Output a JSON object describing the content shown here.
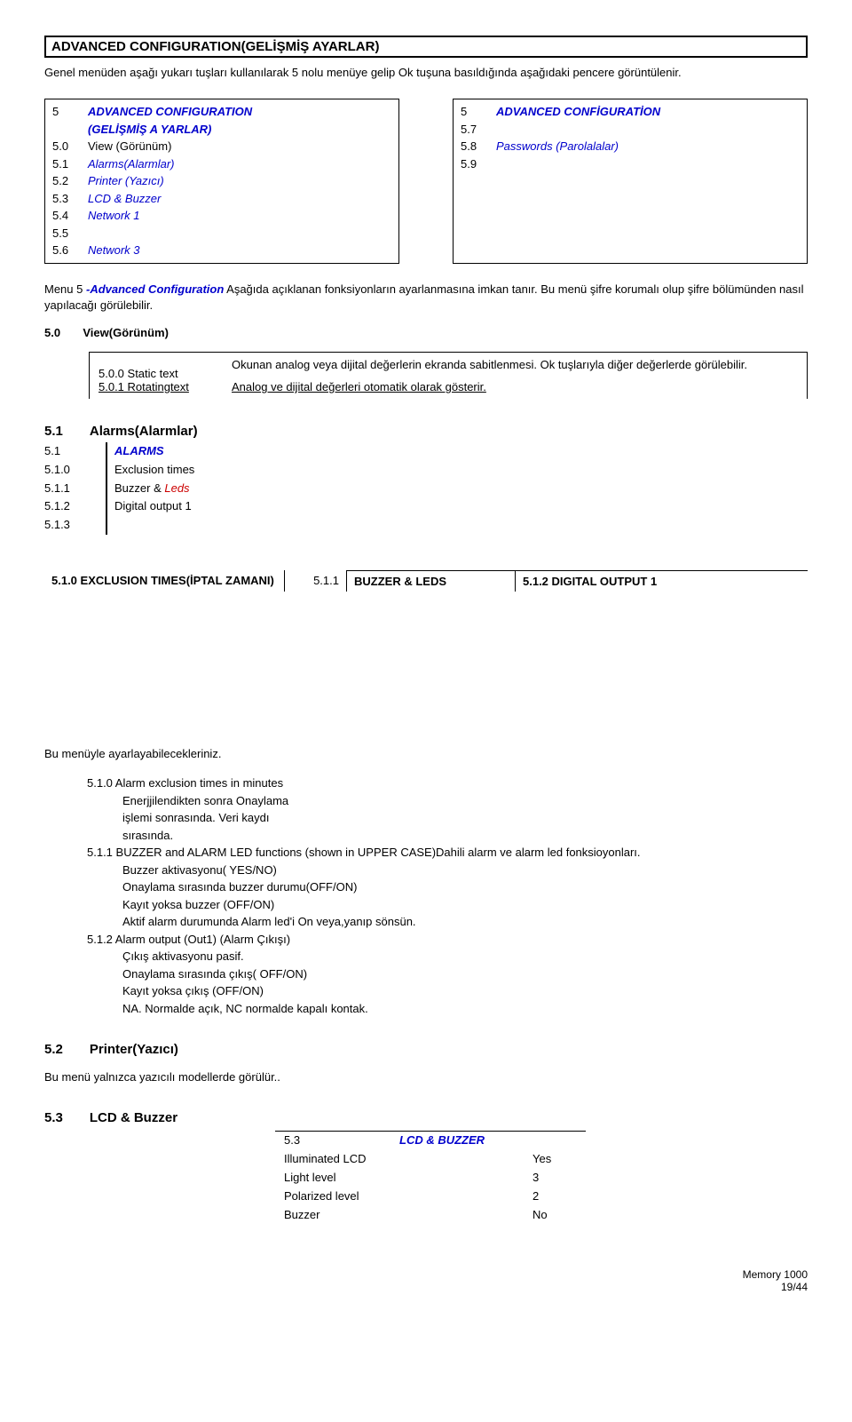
{
  "title": "ADVANCED CONFIGURATION(GELİŞMİŞ AYARLAR)",
  "intro": "Genel menüden aşağı yukarı tuşları kullanılarak 5 nolu menüye gelip Ok tuşuna basıldığında aşağıdaki pencere görüntülenir.",
  "menuLeft": {
    "items": [
      {
        "n": "5",
        "t": "ADVANCED CONFIGURATION",
        "cls": "blue-bold-italic"
      },
      {
        "n": "",
        "t": "(GELİŞMİŞ A YARLAR)",
        "cls": "blue-bold-italic"
      },
      {
        "n": "5.0",
        "t": "View  (Görünüm)",
        "cls": ""
      },
      {
        "n": "5.1",
        "t": "Alarms(Alarmlar)",
        "cls": "blue-italic"
      },
      {
        "n": "5.2",
        "t": "Printer (Yazıcı)",
        "cls": "blue-italic"
      },
      {
        "n": "5.3",
        "t": "LCD & Buzzer",
        "cls": "blue-italic"
      },
      {
        "n": "5.4",
        "t": "Network 1",
        "cls": "blue-italic"
      },
      {
        "n": "5.5",
        "t": "",
        "cls": ""
      },
      {
        "n": "5.6",
        "t": "Network 3",
        "cls": "blue-italic"
      }
    ]
  },
  "menuRight": {
    "header": {
      "n": "5",
      "t": "ADVANCED CONFİGURATİON"
    },
    "items": [
      {
        "n": "5.7",
        "t": ""
      },
      {
        "n": "5.8",
        "t": "Passwords (Parolalalar)"
      },
      {
        "n": "5.9",
        "t": ""
      }
    ]
  },
  "menu5desc": {
    "pre": "Menu 5 ",
    "link": "-Advanced Configuration",
    "post": " Aşağıda açıklanan fonksiyonların ayarlanmasına imkan tanır. Bu menü şifre korumalı olup şifre bölümünden nasıl yapılacağı görülebilir."
  },
  "s50": {
    "n": "5.0",
    "t": "View(Görünüm)"
  },
  "s50box": {
    "r1l": "5.0.0 Static text",
    "r1r": "Okunan analog veya dijital değerlerin ekranda sabitlenmesi. Ok tuşlarıyla diğer değerlerde görülebilir.",
    "r2l": "5.0.1 Rotatingtext",
    "r2r": "Analog ve dijital değerleri otomatik olarak gösterir."
  },
  "s51head": {
    "n": "5.1",
    "t": "Alarms(Alarmlar)"
  },
  "alarms": {
    "left": [
      "5.1",
      "5.1.0",
      "5.1.1",
      "5.1.2",
      "5.1.3"
    ],
    "right": [
      {
        "t": "ALARMS",
        "cls": "blue-bold-italic"
      },
      {
        "t": "Exclusion times",
        "cls": ""
      },
      {
        "t": "Buzzer & Leds",
        "cls": ""
      },
      {
        "t": "Digital output 1",
        "cls": ""
      },
      {
        "t": "",
        "cls": ""
      }
    ]
  },
  "triple": {
    "c1": "5.1.0 EXCLUSION TIMES(İPTAL ZAMANI)",
    "cm": "5.1.1",
    "c2": "BUZZER & LEDS",
    "c3": "5.1.2 DIGITAL OUTPUT 1"
  },
  "listHead": "Bu menüyle ayarlayabilecekleriniz.",
  "list": [
    {
      "i": 0,
      "t": "5.1.0 Alarm exclusion times in minutes"
    },
    {
      "i": 1,
      "t": "Enerjjilendikten sonra Onaylama"
    },
    {
      "i": 1,
      "t": "işlemi sonrasında. Veri kaydı"
    },
    {
      "i": 1,
      "t": "sırasında."
    },
    {
      "i": 0,
      "t": "5.1.1 BUZZER and ALARM LED functions (shown in UPPER CASE)Dahili alarm ve alarm led fonksioyonları."
    },
    {
      "i": 1,
      "t": "Buzzer aktivasyonu( YES/NO)"
    },
    {
      "i": 1,
      "t": "Onaylama sırasında buzzer durumu(OFF/ON)"
    },
    {
      "i": 1,
      "t": "Kayıt yoksa buzzer (OFF/ON)"
    },
    {
      "i": 1,
      "t": "Aktif alarm durumunda Alarm led'i On veya,yanıp sönsün."
    },
    {
      "i": 0,
      "t": "5.1.2 Alarm output (Out1) (Alarm Çıkışı)"
    },
    {
      "i": 1,
      "t": "Çıkış aktivasyonu pasif."
    },
    {
      "i": 1,
      "t": "Onaylama sırasında çıkış( OFF/ON)"
    },
    {
      "i": 1,
      "t": "Kayıt yoksa çıkış (OFF/ON)"
    },
    {
      "i": 1,
      "t": "NA. Normalde açık, NC normalde kapalı kontak."
    }
  ],
  "s52": {
    "n": "5.2",
    "t": "Printer(Yazıcı)"
  },
  "s52desc": "Bu menü yalnızca yazıcılı modellerde görülür..",
  "s53": {
    "n": "5.3",
    "t": "LCD & Buzzer"
  },
  "lcdtbl": {
    "head": {
      "n": "5.3",
      "t": "LCD & BUZZER"
    },
    "rows": [
      {
        "l": "Illuminated LCD",
        "v": "Yes"
      },
      {
        "l": "Light level",
        "v": "3"
      },
      {
        "l": "Polarized level",
        "v": "2"
      },
      {
        "l": "Buzzer",
        "v": "No"
      }
    ]
  },
  "footer": {
    "a": "Memory 1000",
    "b": "19/44"
  }
}
